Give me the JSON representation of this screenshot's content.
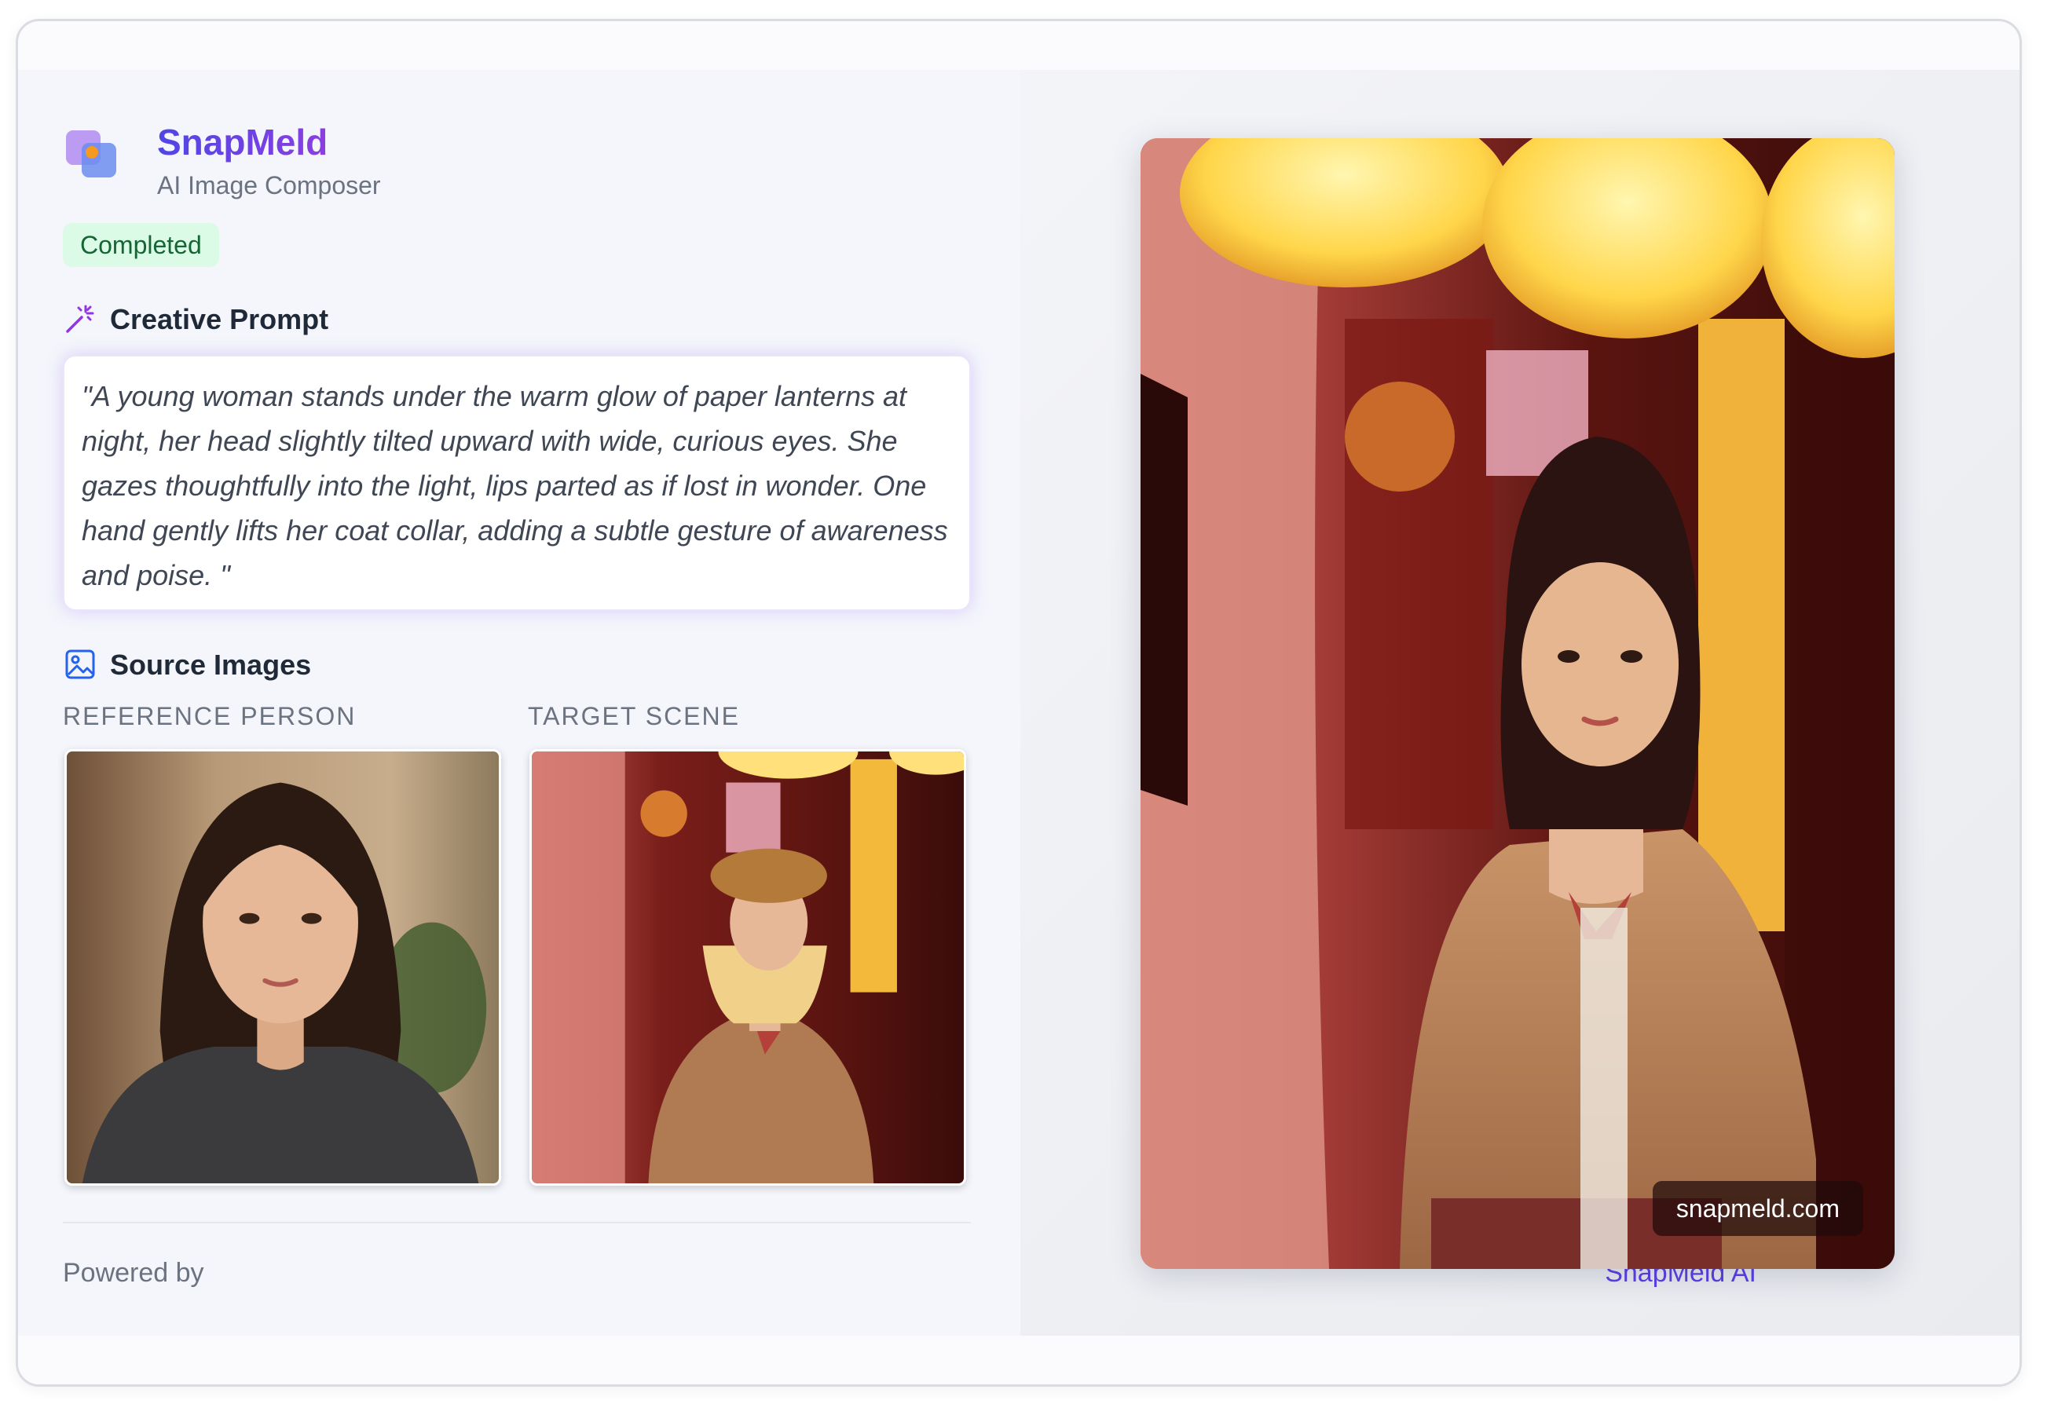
{
  "app": {
    "name": "SnapMeld",
    "tagline": "AI Image Composer",
    "status": "Completed",
    "brand_color": "#5b3fe8",
    "status_color": "#166534"
  },
  "prompt": {
    "heading": "Creative Prompt",
    "icon": "magic-wand-icon",
    "text": "\"A young woman stands under the warm glow of paper lanterns at night, her head slightly tilted upward with wide, curious eyes. She gazes thoughtfully into the light, lips parted as if lost in wonder. One hand gently lifts her coat collar, adding a subtle gesture of awareness and poise. \""
  },
  "source_images": {
    "heading": "Source Images",
    "icon": "image-icon",
    "reference_label": "REFERENCE PERSON",
    "target_label": "TARGET SCENE"
  },
  "footer": {
    "powered_by": "Powered by",
    "link": "SnapMeld AI"
  },
  "result": {
    "watermark": "snapmeld.com"
  }
}
